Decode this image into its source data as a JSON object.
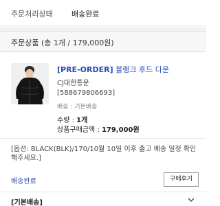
{
  "status_row": {
    "label": "주문처리상태",
    "value": "배송완료"
  },
  "order_section": {
    "title": "주문상품 (총 1개 / 179,000원)"
  },
  "product": {
    "tag": "[PRE-ORDER]",
    "name": "블랭크 후드 다운",
    "seller": "CJ대한통운",
    "order_number": "[588679806693]",
    "shipping": "배송 : 기본배송",
    "qty_label": "수량 : ",
    "qty_value": "1개",
    "price_label": "상품구매금액 : ",
    "price_value": "179,000원"
  },
  "option_note": "[옵션: BLACK(BLK)/170/10월 10일 이후 출고 배송 일정 확인해주세요.]",
  "delivery_status": "배송완료",
  "review_button": "구매후기",
  "bottom_section": {
    "title": "[기본배송]"
  },
  "icons": {
    "collapse": "chevron-down-icon"
  },
  "colors": {
    "accent": "#2a49b8"
  }
}
